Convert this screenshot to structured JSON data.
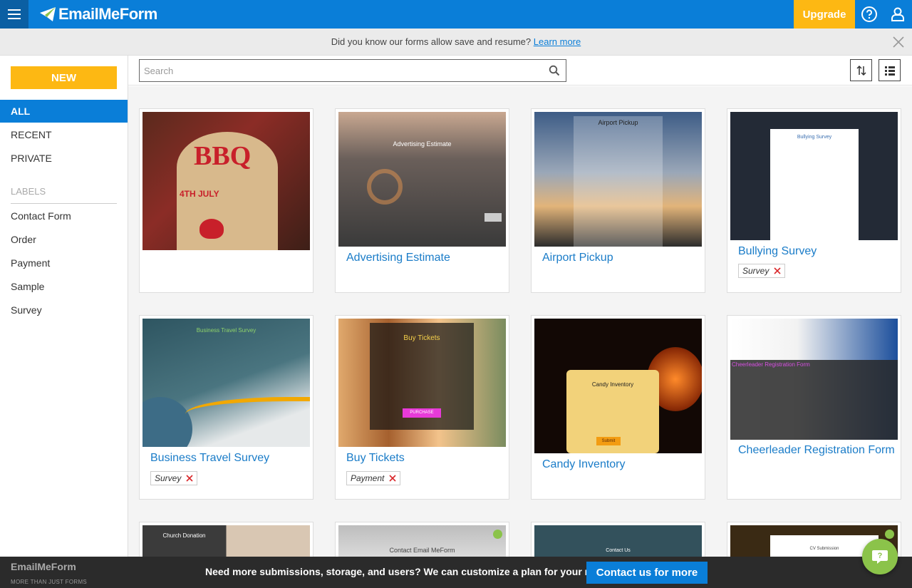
{
  "header": {
    "logo_text": "EmailMeForm",
    "upgrade_label": "Upgrade"
  },
  "infobar": {
    "message": "Did you know our forms allow save and resume?",
    "link": "Learn more"
  },
  "sidebar": {
    "new_label": "NEW",
    "nav": [
      "ALL",
      "RECENT",
      "PRIVATE"
    ],
    "labels_heading": "LABELS",
    "labels": [
      "Contact Form",
      "Order",
      "Payment",
      "Sample",
      "Survey"
    ]
  },
  "toolbar": {
    "search_placeholder": "Search"
  },
  "cards": [
    {
      "title": "",
      "tag": ""
    },
    {
      "title": "Advertising Estimate",
      "tag": ""
    },
    {
      "title": "Airport Pickup",
      "tag": ""
    },
    {
      "title": "Bullying Survey",
      "tag": "Survey"
    },
    {
      "title": "Business Travel Survey",
      "tag": "Survey"
    },
    {
      "title": "Buy Tickets",
      "tag": "Payment"
    },
    {
      "title": "Candy Inventory",
      "tag": ""
    },
    {
      "title": "Cheerleader Registration Form",
      "tag": ""
    }
  ],
  "thumbs": {
    "bbq": "BBQ",
    "bbq_sub": "4TH JULY",
    "advertising": "Advertising Estimate",
    "airport": "Airport Pickup",
    "bullying": "Bullying Survey",
    "business": "Business Travel Survey",
    "buy": "Buy Tickets",
    "buy_btn": "PURCHASE",
    "candy": "Candy Inventory",
    "candy_btn": "Submit",
    "cheer": "Cheerleader Registration Form",
    "church": "Church Donation",
    "contact": "Contact Email MeForm",
    "contact_us": "Contact Us",
    "cv": "CV Submission"
  },
  "footer": {
    "logo": "EmailMeForm",
    "tagline": "MORE THAN JUST FORMS",
    "message": "Need more submissions, storage, and users? We can customize a plan for your needs.",
    "contact_label": "Contact us for more"
  },
  "colors": {
    "primary": "#0a7ed8",
    "accent": "#fdb813",
    "chat": "#8bc34a"
  }
}
